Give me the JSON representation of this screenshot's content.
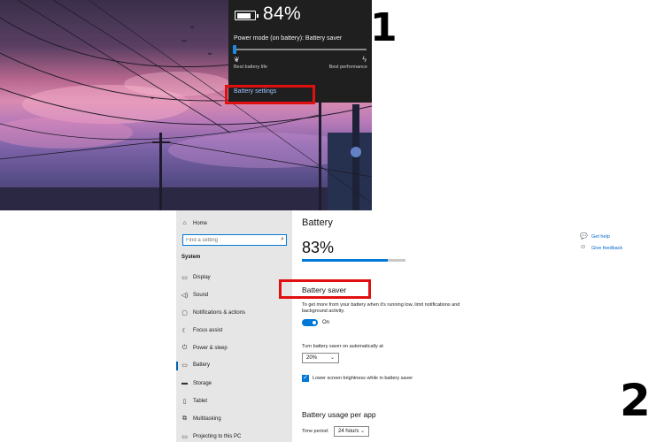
{
  "markers": [
    "1",
    "2"
  ],
  "flyout": {
    "battery_percent": "84%",
    "battery_level": 0.84,
    "power_mode_label": "Power mode (on battery): Battery saver",
    "slider_value": 0,
    "slider_left_label": "Best battery life",
    "slider_right_label": "Best performance",
    "left_icon": "leaf-icon",
    "right_icon": "lightning-icon",
    "battery_settings_link": "Battery settings"
  },
  "settings": {
    "nav": {
      "home_label": "Home",
      "search_placeholder": "Find a setting",
      "section_heading": "System",
      "items": [
        {
          "label": "Display",
          "icon": "display-icon"
        },
        {
          "label": "Sound",
          "icon": "sound-icon"
        },
        {
          "label": "Notifications & actions",
          "icon": "notifications-icon"
        },
        {
          "label": "Focus assist",
          "icon": "moon-icon"
        },
        {
          "label": "Power & sleep",
          "icon": "power-icon"
        },
        {
          "label": "Battery",
          "icon": "battery-icon",
          "active": true
        },
        {
          "label": "Storage",
          "icon": "storage-icon"
        },
        {
          "label": "Tablet",
          "icon": "tablet-icon"
        },
        {
          "label": "Multitasking",
          "icon": "multitasking-icon"
        },
        {
          "label": "Projecting to this PC",
          "icon": "projecting-icon"
        }
      ]
    },
    "content": {
      "title": "Battery",
      "battery_percent": "83%",
      "battery_level": 0.83,
      "battery_saver_heading": "Battery saver",
      "battery_saver_description": "To get more from your battery when it's running low, limit notifications and background activity.",
      "toggle_state": "On",
      "auto_label": "Turn battery saver on automatically at",
      "auto_value": "20%",
      "brightness_checkbox_label": "Lower screen brightness while in battery saver",
      "usage_heading": "Battery usage per app",
      "time_period_label": "Time period:",
      "time_period_value": "24 hours"
    },
    "help": {
      "get_help": "Get help",
      "give_feedback": "Give feedback"
    }
  },
  "colors": {
    "accent": "#0078d7",
    "highlight": "#e01010",
    "flyout_bg": "#1f1f1f",
    "nav_bg": "#e6e6e6"
  }
}
